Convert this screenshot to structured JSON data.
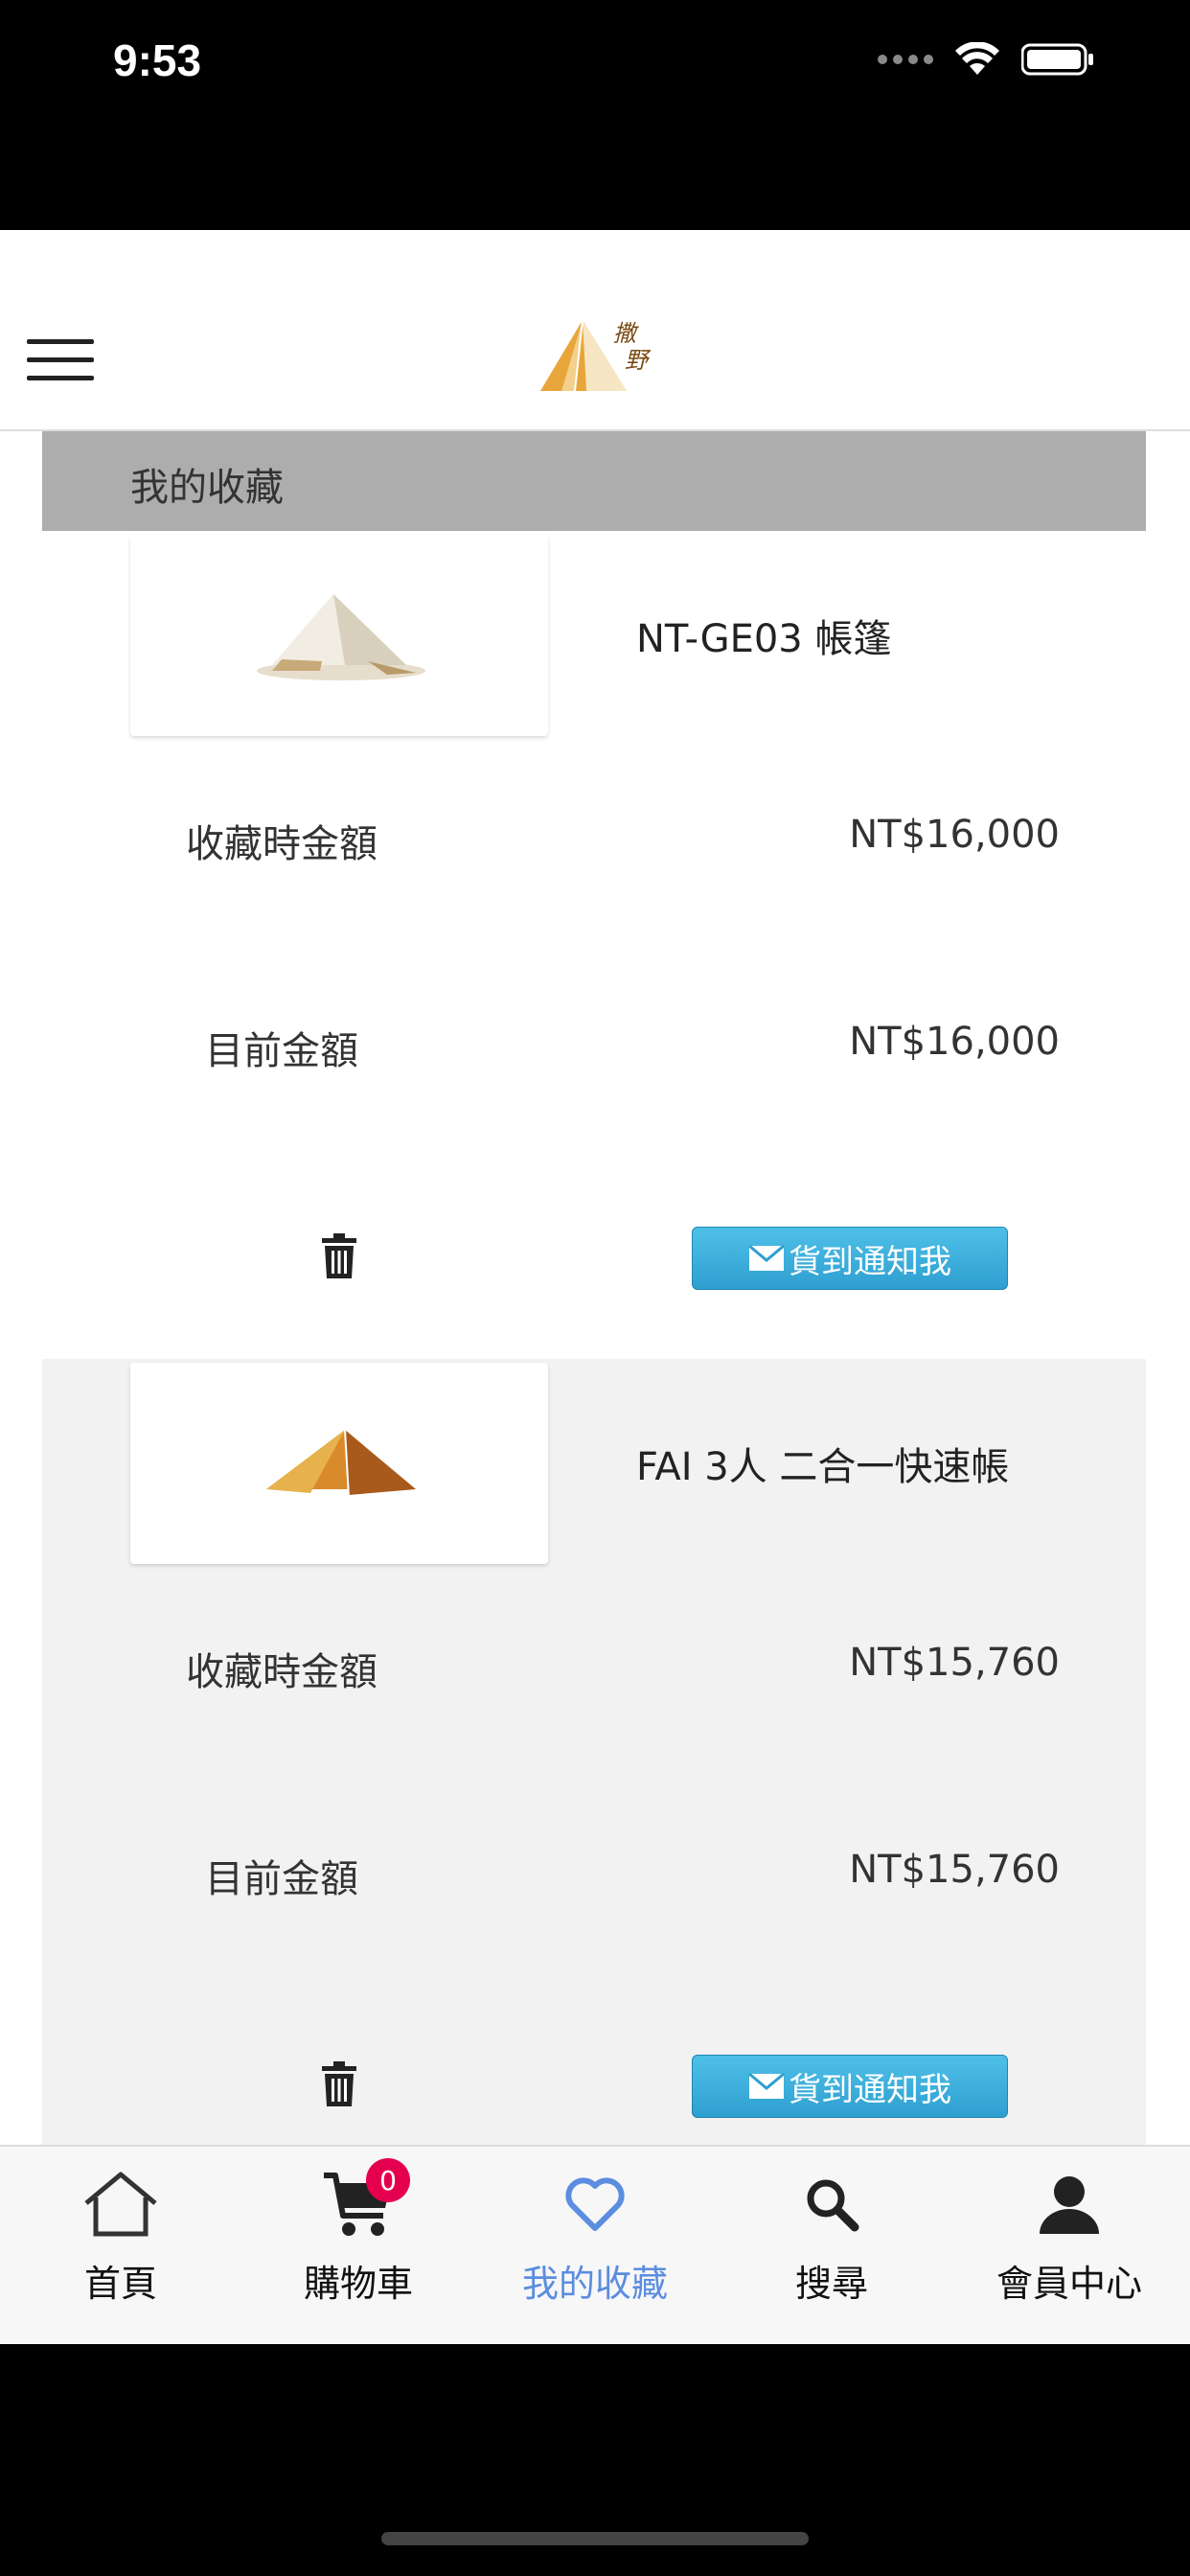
{
  "status_bar": {
    "time": "9:53"
  },
  "header": {
    "logo_text": "撒野"
  },
  "favorites": {
    "section_title": "我的收藏",
    "items": [
      {
        "name": "NT-GE03 帳篷",
        "saved_price_label": "收藏時金額",
        "saved_price": "NT$16,000",
        "current_price_label": "目前金額",
        "current_price": "NT$16,000",
        "notify_label": "貨到通知我"
      },
      {
        "name": "FAI 3人 二合一快速帳",
        "saved_price_label": "收藏時金額",
        "saved_price": "NT$15,760",
        "current_price_label": "目前金額",
        "current_price": "NT$15,760",
        "notify_label": "貨到通知我"
      }
    ]
  },
  "tabbar": {
    "tabs": [
      {
        "label": "首頁",
        "icon": "home-icon"
      },
      {
        "label": "購物車",
        "icon": "cart-icon",
        "badge": "0"
      },
      {
        "label": "我的收藏",
        "icon": "heart-icon"
      },
      {
        "label": "搜尋",
        "icon": "search-icon"
      },
      {
        "label": "會員中心",
        "icon": "user-icon"
      }
    ],
    "active_index": 2,
    "active_color": "#5b8de0"
  },
  "colors": {
    "notify_button": "#3aaee0",
    "badge": "#e5004f",
    "section_bar": "#adadad"
  }
}
